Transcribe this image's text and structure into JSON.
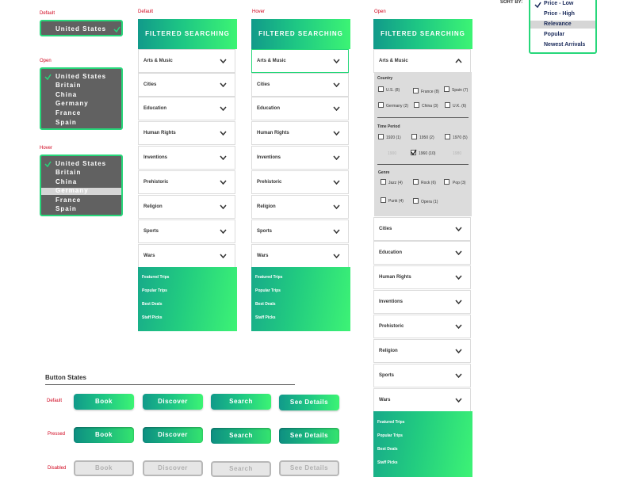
{
  "states": {
    "default": "Default",
    "open": "Open",
    "hover": "Hover",
    "pressed": "Pressed",
    "disabled": "Disabled"
  },
  "country_dropdown": {
    "selected": "United States",
    "options": [
      "United States",
      "Britain",
      "China",
      "Germany",
      "France",
      "Spain"
    ],
    "hover_option": "Germany"
  },
  "filter": {
    "title": "FILTERED SEARCHING",
    "categories": [
      "Arts & Music",
      "Cities",
      "Education",
      "Human Rights",
      "Inventions",
      "Prehistoric",
      "Religion",
      "Sports",
      "Wars"
    ],
    "footer_links": [
      "Featured Trips",
      "Popular Trips",
      "Best Deals",
      "Staff Picks"
    ],
    "expanded": {
      "country_heading": "Country",
      "countries": [
        "U.S. (8)",
        "France (8)",
        "Spain (7)",
        "Germany (2)",
        "China (3)",
        "U.K. (6)"
      ],
      "period_heading": "Time Period",
      "periods": [
        "1920 (1)",
        "1950 (2)",
        "1970 (5)",
        "1960 (10)"
      ],
      "periods_disabled": [
        "1900",
        "1980"
      ],
      "genre_heading": "Genre",
      "genres": [
        "Jazz (4)",
        "Rock (6)",
        "Pop (3)",
        "Punk (4)",
        "Opera (1)"
      ]
    }
  },
  "sort": {
    "title": "SORT BY:",
    "options": [
      "Price - Low",
      "Price - High",
      "Relevance",
      "Popular",
      "Newest Arrivals"
    ],
    "checked": "Price - Low",
    "highlighted": "Relevance"
  },
  "buttons": {
    "section_title": "Button States",
    "labels": [
      "Book",
      "Discover",
      "Search",
      "See Details"
    ]
  },
  "colors": {
    "accent_start": "#119a8a",
    "accent_end": "#3cf474",
    "state_label": "#d0021b",
    "dropdown_bg": "#616161"
  }
}
